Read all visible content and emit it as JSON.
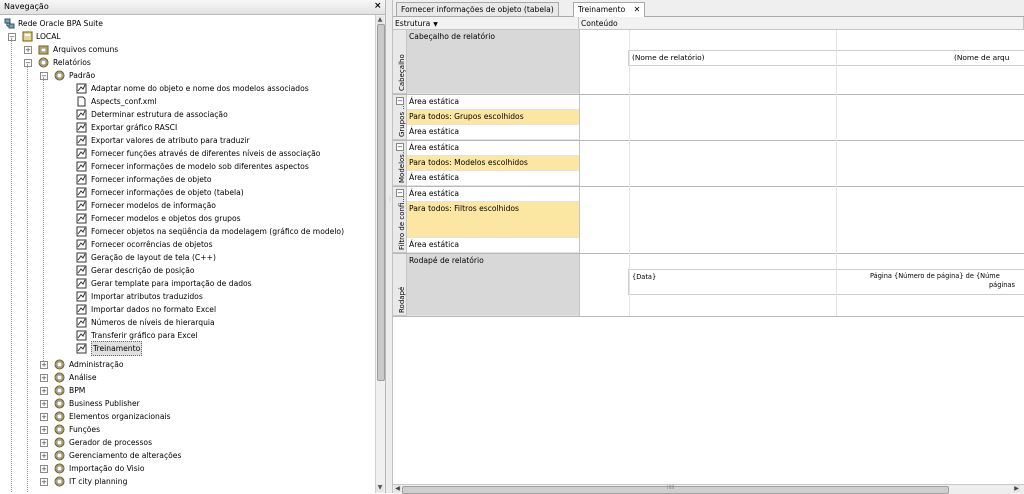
{
  "nav": {
    "title": "Navegação",
    "close": "×",
    "root": "Rede Oracle BPA Suite",
    "local": "LOCAL",
    "common": "Arquivos comuns",
    "reports": "Relatórios",
    "standard": "Padrão",
    "items": [
      "Adaptar nome do objeto e nome dos modelos associados",
      "Aspects_conf.xml",
      "Determinar estrutura de associação",
      "Exportar gráfico RASCI",
      "Exportar valores de atributo para traduzir",
      "Fornecer funções através de diferentes níveis de associação",
      "Fornecer informações de modelo sob diferentes aspectos",
      "Fornecer informações de objeto",
      "Fornecer informações de objeto (tabela)",
      "Fornecer modelos de informação",
      "Fornecer modelos e objetos dos grupos",
      "Fornecer objetos na seqüência da modelagem (gráfico de modelo)",
      "Fornecer ocorrências de objetos",
      "Geração de layout de tela (C++)",
      "Gerar descrição de posição",
      "Gerar template para importação de dados",
      "Importar atributos traduzidos",
      "Importar dados no formato Excel",
      "Números de níveis de hierarquia",
      "Transferir gráfico para Excel",
      "Treinamento"
    ],
    "folders": [
      "Administração",
      "Análise",
      "BPM",
      "Business Publisher",
      "Elementos organizacionais",
      "Funções",
      "Gerador de processos",
      "Gerenciamento de alterações",
      "Importação do Visio",
      "IT city planning"
    ]
  },
  "tabs": [
    {
      "label": "Fornecer informações de objeto (tabela)"
    },
    {
      "label": "Treinamento",
      "close": "✕"
    }
  ],
  "grid": {
    "col_structure": "Estrutura",
    "col_content": "Conteúdo",
    "sections": {
      "header": "Cabeçalho",
      "groups": "Grupos ...",
      "models": "Modelos...",
      "filter": "Filtro de confi...",
      "footer": "Rodapé"
    },
    "rows": {
      "report_header": "Cabeçalho de relatório",
      "static1": "Área estática",
      "for_groups": "Para todos: Grupos escolhidos",
      "static2": "Área estática",
      "static3": "Área estática",
      "for_models": "Para todos: Modelos escolhidos",
      "static4": "Área estática",
      "static5": "Área estática",
      "for_filters": "Para todos: Filtros escolhidos",
      "static6": "Área estática",
      "report_footer": "Rodapé de relatório"
    },
    "content": {
      "report_name": "(Nome de relatório)",
      "file_name": "(Nome de arqu",
      "date": "{Data}",
      "page": "Página {Número de página} de {Núme",
      "pages": "páginas"
    }
  },
  "scroll_grip": "IIIII"
}
